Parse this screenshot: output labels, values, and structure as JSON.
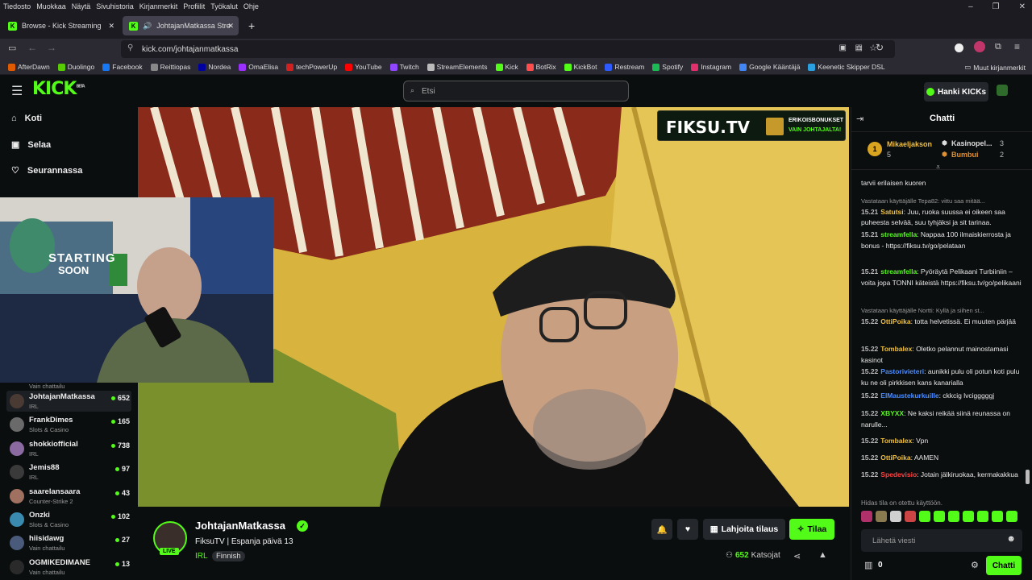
{
  "menubar": [
    "Tiedosto",
    "Muokkaa",
    "Näytä",
    "Sivuhistoria",
    "Kirjanmerkit",
    "Profiilit",
    "Työkalut",
    "Ohje"
  ],
  "tabs": [
    {
      "label": "Browse - Kick Streaming"
    },
    {
      "label": "JohtajanMatkassa Stream -"
    }
  ],
  "url": "kick.com/johtajanmatkassa",
  "bookmarks": [
    {
      "label": "AfterDawn",
      "color": "#e05a00"
    },
    {
      "label": "Duolingo",
      "color": "#58cc02"
    },
    {
      "label": "Facebook",
      "color": "#1877f2"
    },
    {
      "label": "Reittiopas",
      "color": "#888888"
    },
    {
      "label": "Nordea",
      "color": "#0000a0"
    },
    {
      "label": "OmaElisa",
      "color": "#9b30ff"
    },
    {
      "label": "techPowerUp",
      "color": "#d02020"
    },
    {
      "label": "YouTube",
      "color": "#ff0000"
    },
    {
      "label": "Twitch",
      "color": "#9146ff"
    },
    {
      "label": "StreamElements",
      "color": "#bbbbbb"
    },
    {
      "label": "Kick",
      "color": "#53fc18"
    },
    {
      "label": "BotRix",
      "color": "#ff4d4d"
    },
    {
      "label": "KickBot",
      "color": "#53fc18"
    },
    {
      "label": "Restream",
      "color": "#2d5bff"
    },
    {
      "label": "Spotify",
      "color": "#1db954"
    },
    {
      "label": "Instagram",
      "color": "#e1306c"
    },
    {
      "label": "Google Kääntäjä",
      "color": "#4285f4"
    },
    {
      "label": "Keenetic Skipper DSL",
      "color": "#2aa0e0"
    }
  ],
  "bookmarks_other": "Muut kirjanmerkit",
  "kick": {
    "logo": "KICK",
    "beta": "BETA",
    "search_placeholder": "Etsi",
    "kicks_button": "Hanki KICKs",
    "brand": "#53fc18"
  },
  "nav": [
    {
      "label": "Koti",
      "icon": "home-icon"
    },
    {
      "label": "Selaa",
      "icon": "browse-icon"
    },
    {
      "label": "Seurannassa",
      "icon": "heart-icon"
    }
  ],
  "channels": [
    {
      "name": "",
      "category": "Vain chattailu",
      "viewers": ""
    },
    {
      "name": "JohtajanMatkassa",
      "category": "IRL",
      "viewers": "652"
    },
    {
      "name": "FrankDimes",
      "category": "Slots & Casino",
      "viewers": "165"
    },
    {
      "name": "shokkiofficial",
      "category": "IRL",
      "viewers": "738"
    },
    {
      "name": "Jemis88",
      "category": "IRL",
      "viewers": "97"
    },
    {
      "name": "saarelansaara",
      "category": "Counter-Strike 2",
      "viewers": "43"
    },
    {
      "name": "Onzki",
      "category": "Slots & Casino",
      "viewers": "102"
    },
    {
      "name": "hiisidawg",
      "category": "Vain chattailu",
      "viewers": "27"
    },
    {
      "name": "OGMIKEDIMANE",
      "category": "Vain chattailu",
      "viewers": "13"
    }
  ],
  "video": {
    "overlay_brand": "FIKSU.TV",
    "overlay_line1": "ERIKOISBONUKSET",
    "overlay_line2": "VAIN JOHTAJALTA!",
    "facecam_text1": "STARTING",
    "facecam_text2": "SOON"
  },
  "stream": {
    "name": "JohtajanMatkassa",
    "title": "FiksuTV | Espanja päivä 13",
    "category": "IRL",
    "language": "Finnish",
    "live": "LIVE",
    "viewers": "652",
    "viewers_label": "Katsojat",
    "subscribe": "Lahjoita tilaus",
    "follow": "Tilaa"
  },
  "chat": {
    "title": "Chatti",
    "top": [
      {
        "rank": "1",
        "name": "Mikaeljakson",
        "count": "5"
      },
      {
        "name": "Kasinopel...",
        "count": "3"
      },
      {
        "name": "Bumbui",
        "count": "2"
      }
    ],
    "messages": [
      {
        "reply": "",
        "time": "",
        "user": "",
        "color": "#ffffff",
        "text": "tarvii erilaisen kuoren"
      },
      {
        "reply": "Vastataan käyttäjälle Tepa82: vittu saa mitää...",
        "time": "15.21",
        "user": "Satutsi",
        "color": "#f0c040",
        "text": "Juu, ruoka suussa ei oikeen saa puheesta selvää, suu tyhjäksi ja sit tarinaa."
      },
      {
        "reply": "",
        "time": "15.21",
        "user": "streamfella",
        "color": "#53fc18",
        "text": "Nappaa 100 ilmaiskierrosta ja bonus - https://fiksu.tv/go/pelataan"
      },
      {
        "reply": "",
        "time": "15.21",
        "user": "streamfella",
        "color": "#53fc18",
        "text": "Pyöräytä Pelikaani Turbiiniin – voita jopa TONNI käteistä https://fiksu.tv/go/pelikaani"
      },
      {
        "reply": "Vastataan käyttäjälle Nortti: Kyllä ja siihen st...",
        "time": "15.22",
        "user": "OttiPoika",
        "color": "#f0c040",
        "text": "totta helvetissä. Ei muuten pärjää"
      },
      {
        "reply": "",
        "time": "15.22",
        "user": "Tombalex",
        "color": "#f0c040",
        "text": "Oletko pelannut mainostamasi kasinot"
      },
      {
        "reply": "",
        "time": "15.22",
        "user": "Pastorivieteri",
        "color": "#4a8cff",
        "text": "aunikki pulu oli potun koti pulu ku ne oli pirkkisen kans kanarialla"
      },
      {
        "reply": "",
        "time": "15.22",
        "user": "ElMaustekurkuille",
        "color": "#4a8cff",
        "text": "ckkcig lvcigggggj"
      },
      {
        "reply": "",
        "time": "15.22",
        "user": "XBYXX",
        "color": "#53fc18",
        "text": "Ne kaksi reikää siinä reunassa on narulle..."
      },
      {
        "reply": "",
        "time": "15.22",
        "user": "Tombalex",
        "color": "#f0c040",
        "text": "Vpn"
      },
      {
        "reply": "",
        "time": "15.22",
        "user": "OttiPoika",
        "color": "#f0c040",
        "text": "AAMEN"
      },
      {
        "reply": "",
        "time": "15.22",
        "user": "Spedevisio",
        "color": "#ff4040",
        "text": "Jotain jälkiruokaa, kermakakkua"
      }
    ],
    "slow_mode": "Hidas tila on otettu käyttöön.",
    "input_placeholder": "Lähetä viesti",
    "kicks_count": "0",
    "send": "Chatti"
  }
}
